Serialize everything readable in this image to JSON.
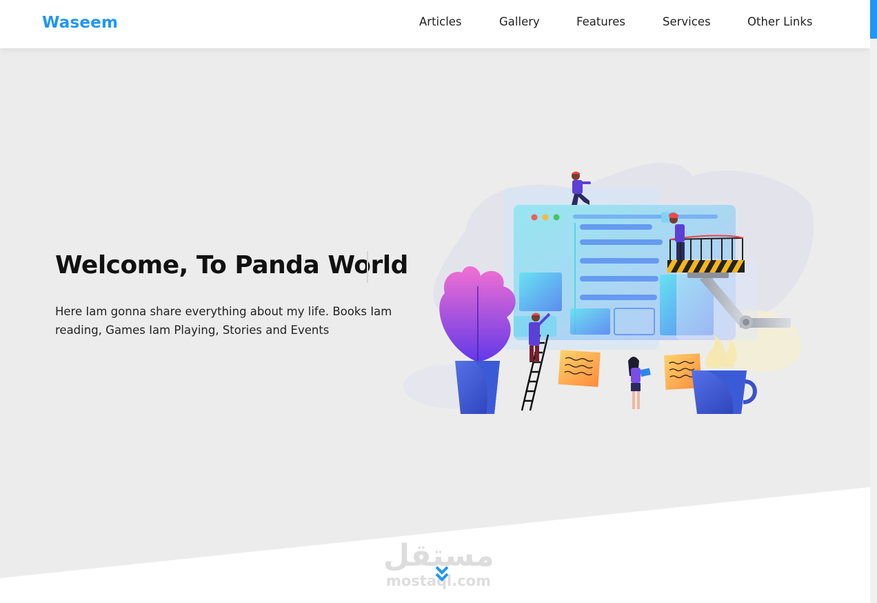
{
  "header": {
    "logo": "Waseem",
    "nav": [
      {
        "label": "Articles"
      },
      {
        "label": "Gallery"
      },
      {
        "label": "Features"
      },
      {
        "label": "Services"
      },
      {
        "label": "Other Links"
      }
    ]
  },
  "hero": {
    "title": "Welcome, To Panda World",
    "description": "Here Iam gonna share everything about my life. Books Iam reading, Games Iam Playing, Stories and Events",
    "illustration_icon": "website-building-illustration"
  },
  "scroll_down_icon": "double-chevron-down-icon",
  "watermark": {
    "arabic": "مستقل",
    "latin": "mostaql.com"
  },
  "colors": {
    "accent": "#2196f3",
    "hero_background": "#ececec",
    "header_background": "#ffffff"
  }
}
